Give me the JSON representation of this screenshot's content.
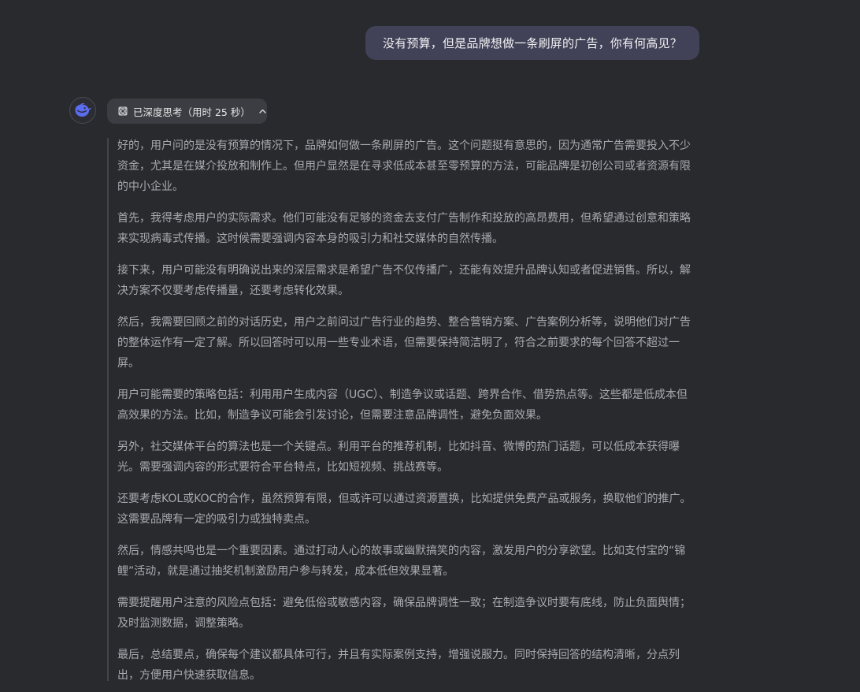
{
  "user_message": "没有预算，但是品牌想做一条刷屏的广告，你有何高见？",
  "assistant": {
    "avatar_icon": "deepseek-whale-icon",
    "thinking_toggle_label": "已深度思考（用时 25 秒）",
    "thinking_paragraphs": [
      "好的，用户问的是没有预算的情况下，品牌如何做一条刷屏的广告。这个问题挺有意思的，因为通常广告需要投入不少资金，尤其是在媒介投放和制作上。但用户显然是在寻求低成本甚至零预算的方法，可能品牌是初创公司或者资源有限的中小企业。",
      "首先，我得考虑用户的实际需求。他们可能没有足够的资金去支付广告制作和投放的高昂费用，但希望通过创意和策略来实现病毒式传播。这时候需要强调内容本身的吸引力和社交媒体的自然传播。",
      "接下来，用户可能没有明确说出来的深层需求是希望广告不仅传播广，还能有效提升品牌认知或者促进销售。所以，解决方案不仅要考虑传播量，还要考虑转化效果。",
      "然后，我需要回顾之前的对话历史，用户之前问过广告行业的趋势、整合营销方案、广告案例分析等，说明他们对广告的整体运作有一定了解。所以回答时可以用一些专业术语，但需要保持简洁明了，符合之前要求的每个回答不超过一屏。",
      "用户可能需要的策略包括：利用用户生成内容（UGC）、制造争议或话题、跨界合作、借势热点等。这些都是低成本但高效果的方法。比如，制造争议可能会引发讨论，但需要注意品牌调性，避免负面效果。",
      "另外，社交媒体平台的算法也是一个关键点。利用平台的推荐机制，比如抖音、微博的热门话题，可以低成本获得曝光。需要强调内容的形式要符合平台特点，比如短视频、挑战赛等。",
      "还要考虑KOL或KOC的合作，虽然预算有限，但或许可以通过资源置换，比如提供免费产品或服务，换取他们的推广。这需要品牌有一定的吸引力或独特卖点。",
      "然后，情感共鸣也是一个重要因素。通过打动人心的故事或幽默搞笑的内容，激发用户的分享欲望。比如支付宝的“锦鲤”活动，就是通过抽奖机制激励用户参与转发，成本低但效果显著。",
      "需要提醒用户注意的风险点包括：避免低俗或敏感内容，确保品牌调性一致；在制造争议时要有底线，防止负面舆情；及时监测数据，调整策略。",
      "最后，总结要点，确保每个建议都具体可行，并且有实际案例支持，增强说服力。同时保持回答的结构清晰，分点列出，方便用户快速获取信息。"
    ]
  }
}
